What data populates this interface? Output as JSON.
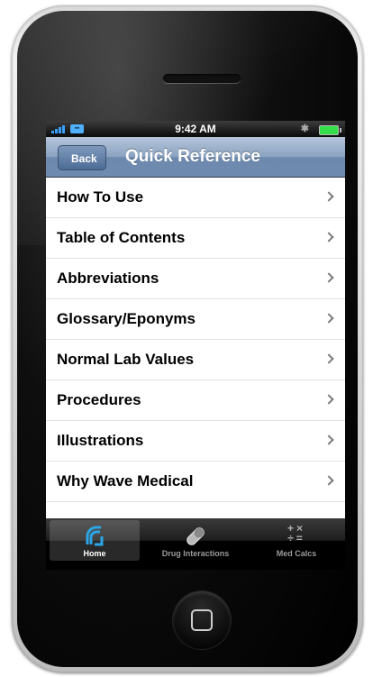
{
  "status_bar": {
    "time": "9:42 AM"
  },
  "nav": {
    "back_label": "Back",
    "title": "Quick Reference"
  },
  "list": {
    "items": [
      {
        "label": "How To Use"
      },
      {
        "label": "Table of Contents"
      },
      {
        "label": "Abbreviations"
      },
      {
        "label": "Glossary/Eponyms"
      },
      {
        "label": "Normal Lab Values"
      },
      {
        "label": "Procedures"
      },
      {
        "label": "Illustrations"
      },
      {
        "label": "Why Wave Medical"
      }
    ]
  },
  "tabbar": {
    "tabs": [
      {
        "label": "Home",
        "icon": "wave-icon",
        "active": true
      },
      {
        "label": "Drug Interactions",
        "icon": "pill-icon",
        "active": false
      },
      {
        "label": "Med Calcs",
        "icon": "calculator-icon",
        "active": false
      }
    ]
  },
  "colors": {
    "nav_bar": "#6d89ad",
    "accent_tab": "#2aa6e8",
    "battery": "#33e04a"
  }
}
